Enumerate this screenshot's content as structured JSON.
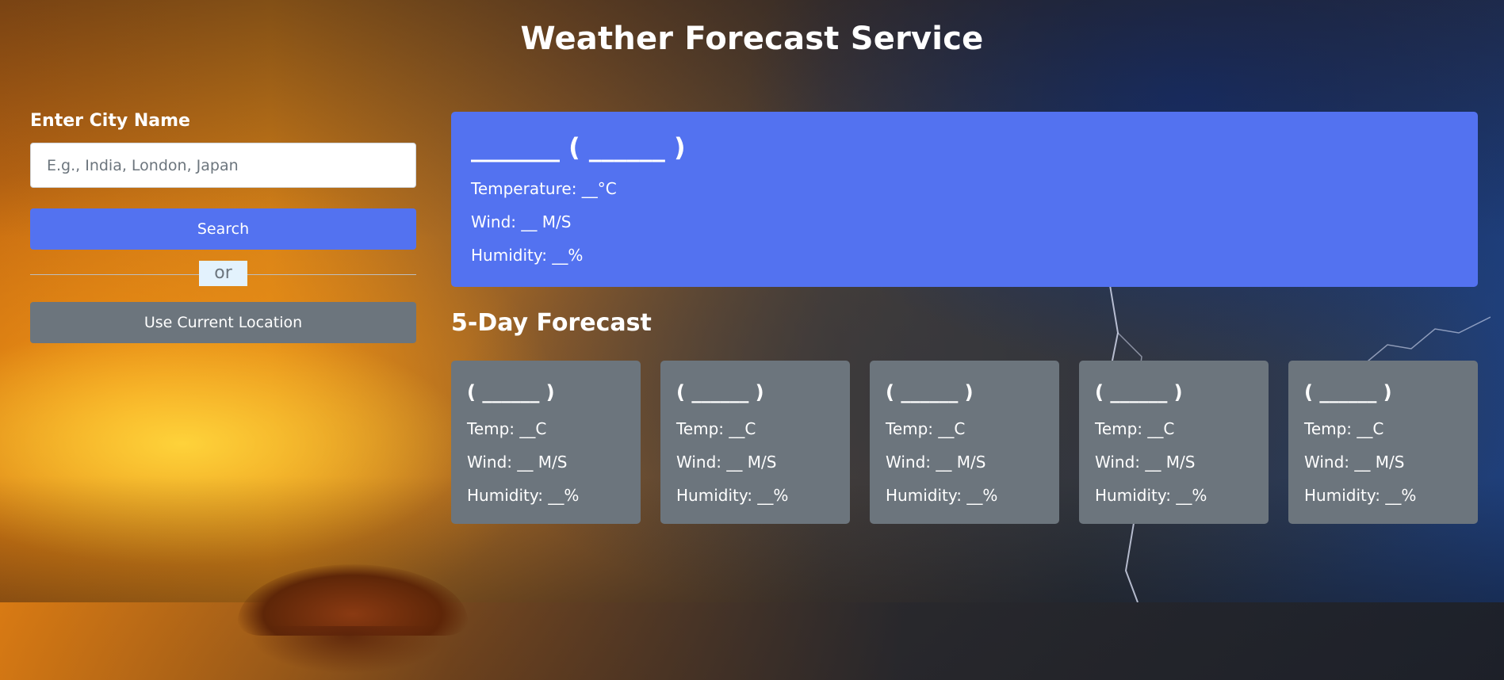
{
  "header": {
    "title": "Weather Forecast Service"
  },
  "search": {
    "label": "Enter City Name",
    "placeholder": "E.g., India, London, Japan",
    "value": "",
    "search_button": "Search",
    "separator": "or",
    "location_button": "Use Current Location"
  },
  "current": {
    "heading": "_______ ( ______ )",
    "temperature": "Temperature: __°C",
    "wind": "Wind: __ M/S",
    "humidity": "Humidity: __%"
  },
  "forecast": {
    "heading": "5-Day Forecast",
    "days": [
      {
        "heading": "( ______ )",
        "temp": "Temp: __C",
        "wind": "Wind: __ M/S",
        "humidity": "Humidity: __%"
      },
      {
        "heading": "( ______ )",
        "temp": "Temp: __C",
        "wind": "Wind: __ M/S",
        "humidity": "Humidity: __%"
      },
      {
        "heading": "( ______ )",
        "temp": "Temp: __C",
        "wind": "Wind: __ M/S",
        "humidity": "Humidity: __%"
      },
      {
        "heading": "( ______ )",
        "temp": "Temp: __C",
        "wind": "Wind: __ M/S",
        "humidity": "Humidity: __%"
      },
      {
        "heading": "( ______ )",
        "temp": "Temp: __C",
        "wind": "Wind: __ M/S",
        "humidity": "Humidity: __%"
      }
    ]
  },
  "colors": {
    "accent": "#5372f0",
    "secondary": "#6c757d",
    "separator_bg": "#e3f2fd",
    "text": "#ffffff"
  }
}
